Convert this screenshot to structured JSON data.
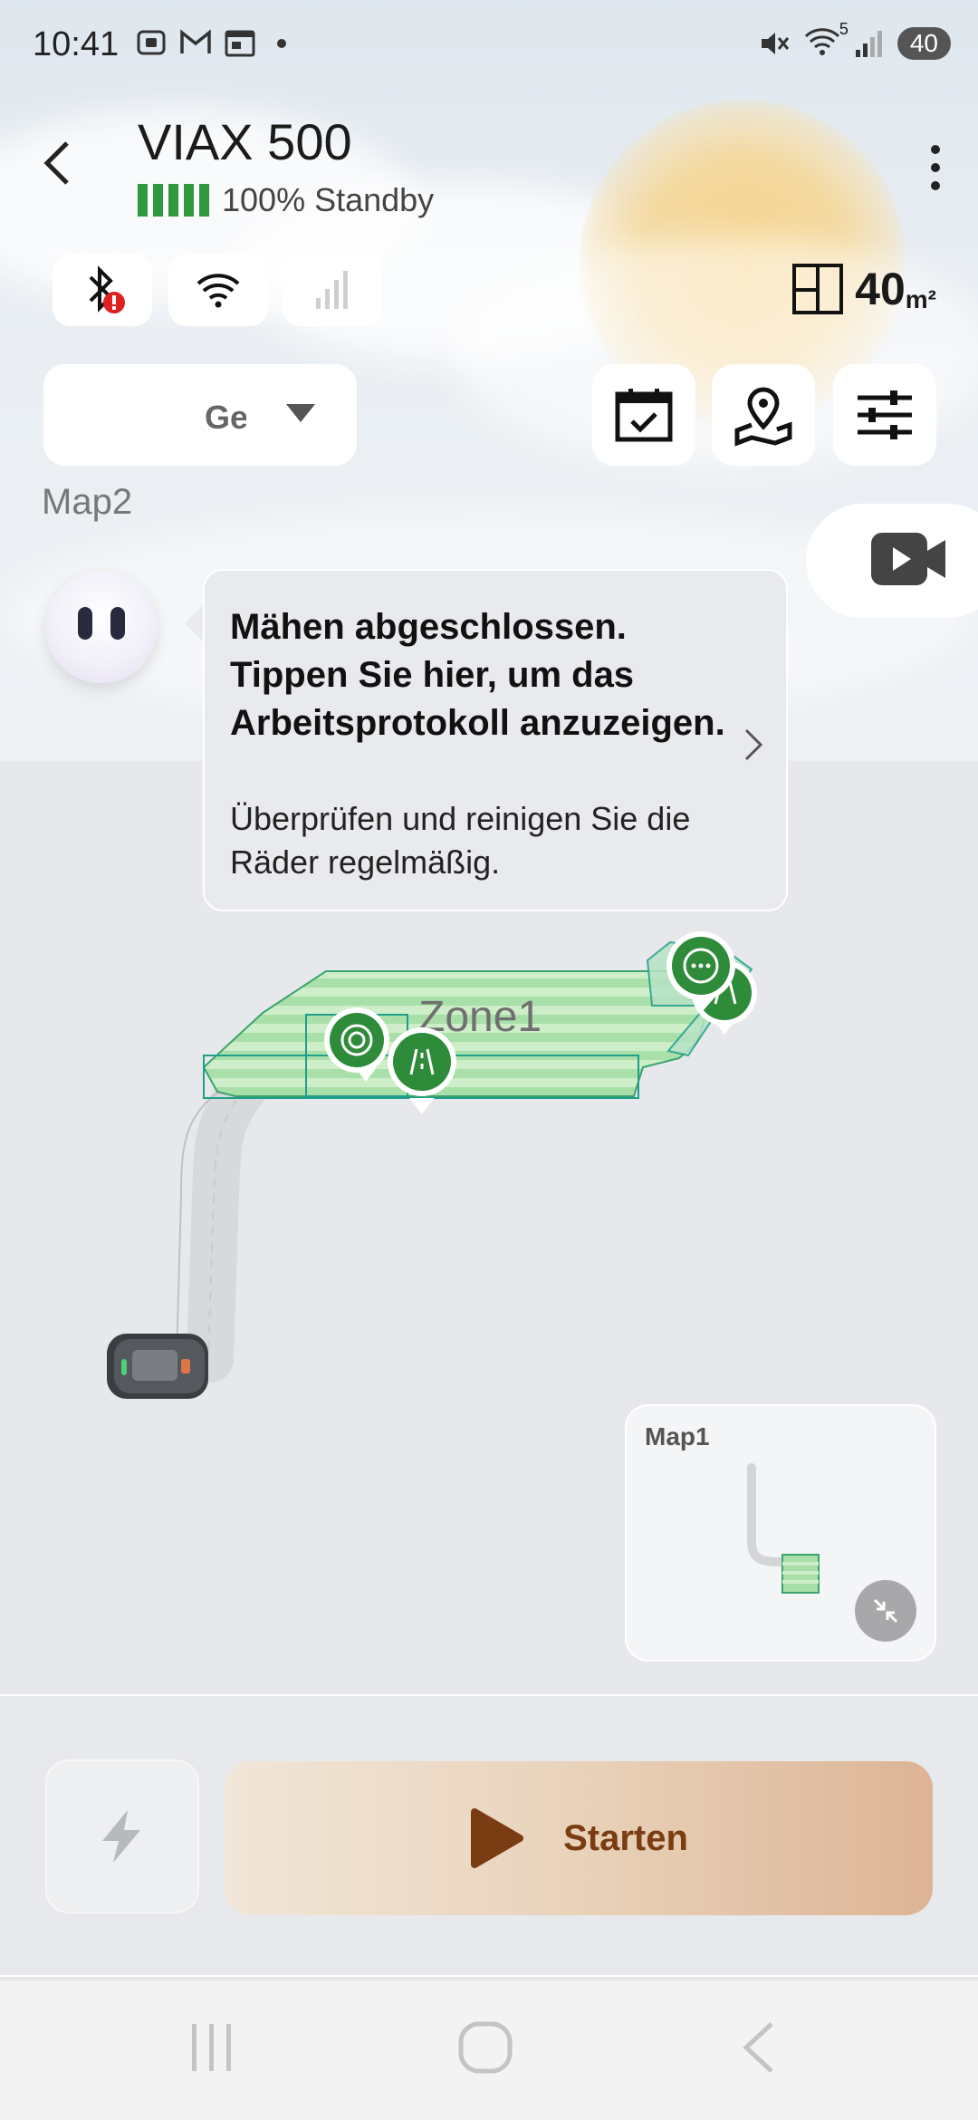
{
  "status_bar": {
    "time": "10:41",
    "battery": "40",
    "network_sup": "5",
    "notification_icons": [
      "screenshot-icon",
      "gmail-icon",
      "calendar-icon",
      "dot-icon"
    ],
    "status_icons": [
      "mute-icon",
      "wifi-icon",
      "signal-icon",
      "battery-icon"
    ]
  },
  "header": {
    "title": "VIAX 500",
    "battery_level": 1.0,
    "battery_text": "100% Standby",
    "connections": [
      "bluetooth-icon",
      "wifi-icon",
      "cellular-icon"
    ],
    "area_value": "40",
    "area_unit": "m²"
  },
  "toolbar": {
    "dropdown_value": "Ges",
    "buttons": [
      "schedule-icon",
      "map-pin-icon",
      "settings-sliders-icon"
    ]
  },
  "map_name": "Map2",
  "notification": {
    "title": "Mähen abgeschlossen. Tippen Sie hier, um das Arbeitsprotokoll anzuzeigen.",
    "subtitle": "Überprüfen und reinigen Sie die Räder regelmäßig."
  },
  "map": {
    "zone_label": "Zone1"
  },
  "minimap": {
    "label": "Map1"
  },
  "bottom": {
    "start_label": "Starten"
  },
  "colors": {
    "accent_green": "#2e8b3a",
    "zone_fill": "#a8deaa",
    "start_text": "#7a3c12"
  }
}
